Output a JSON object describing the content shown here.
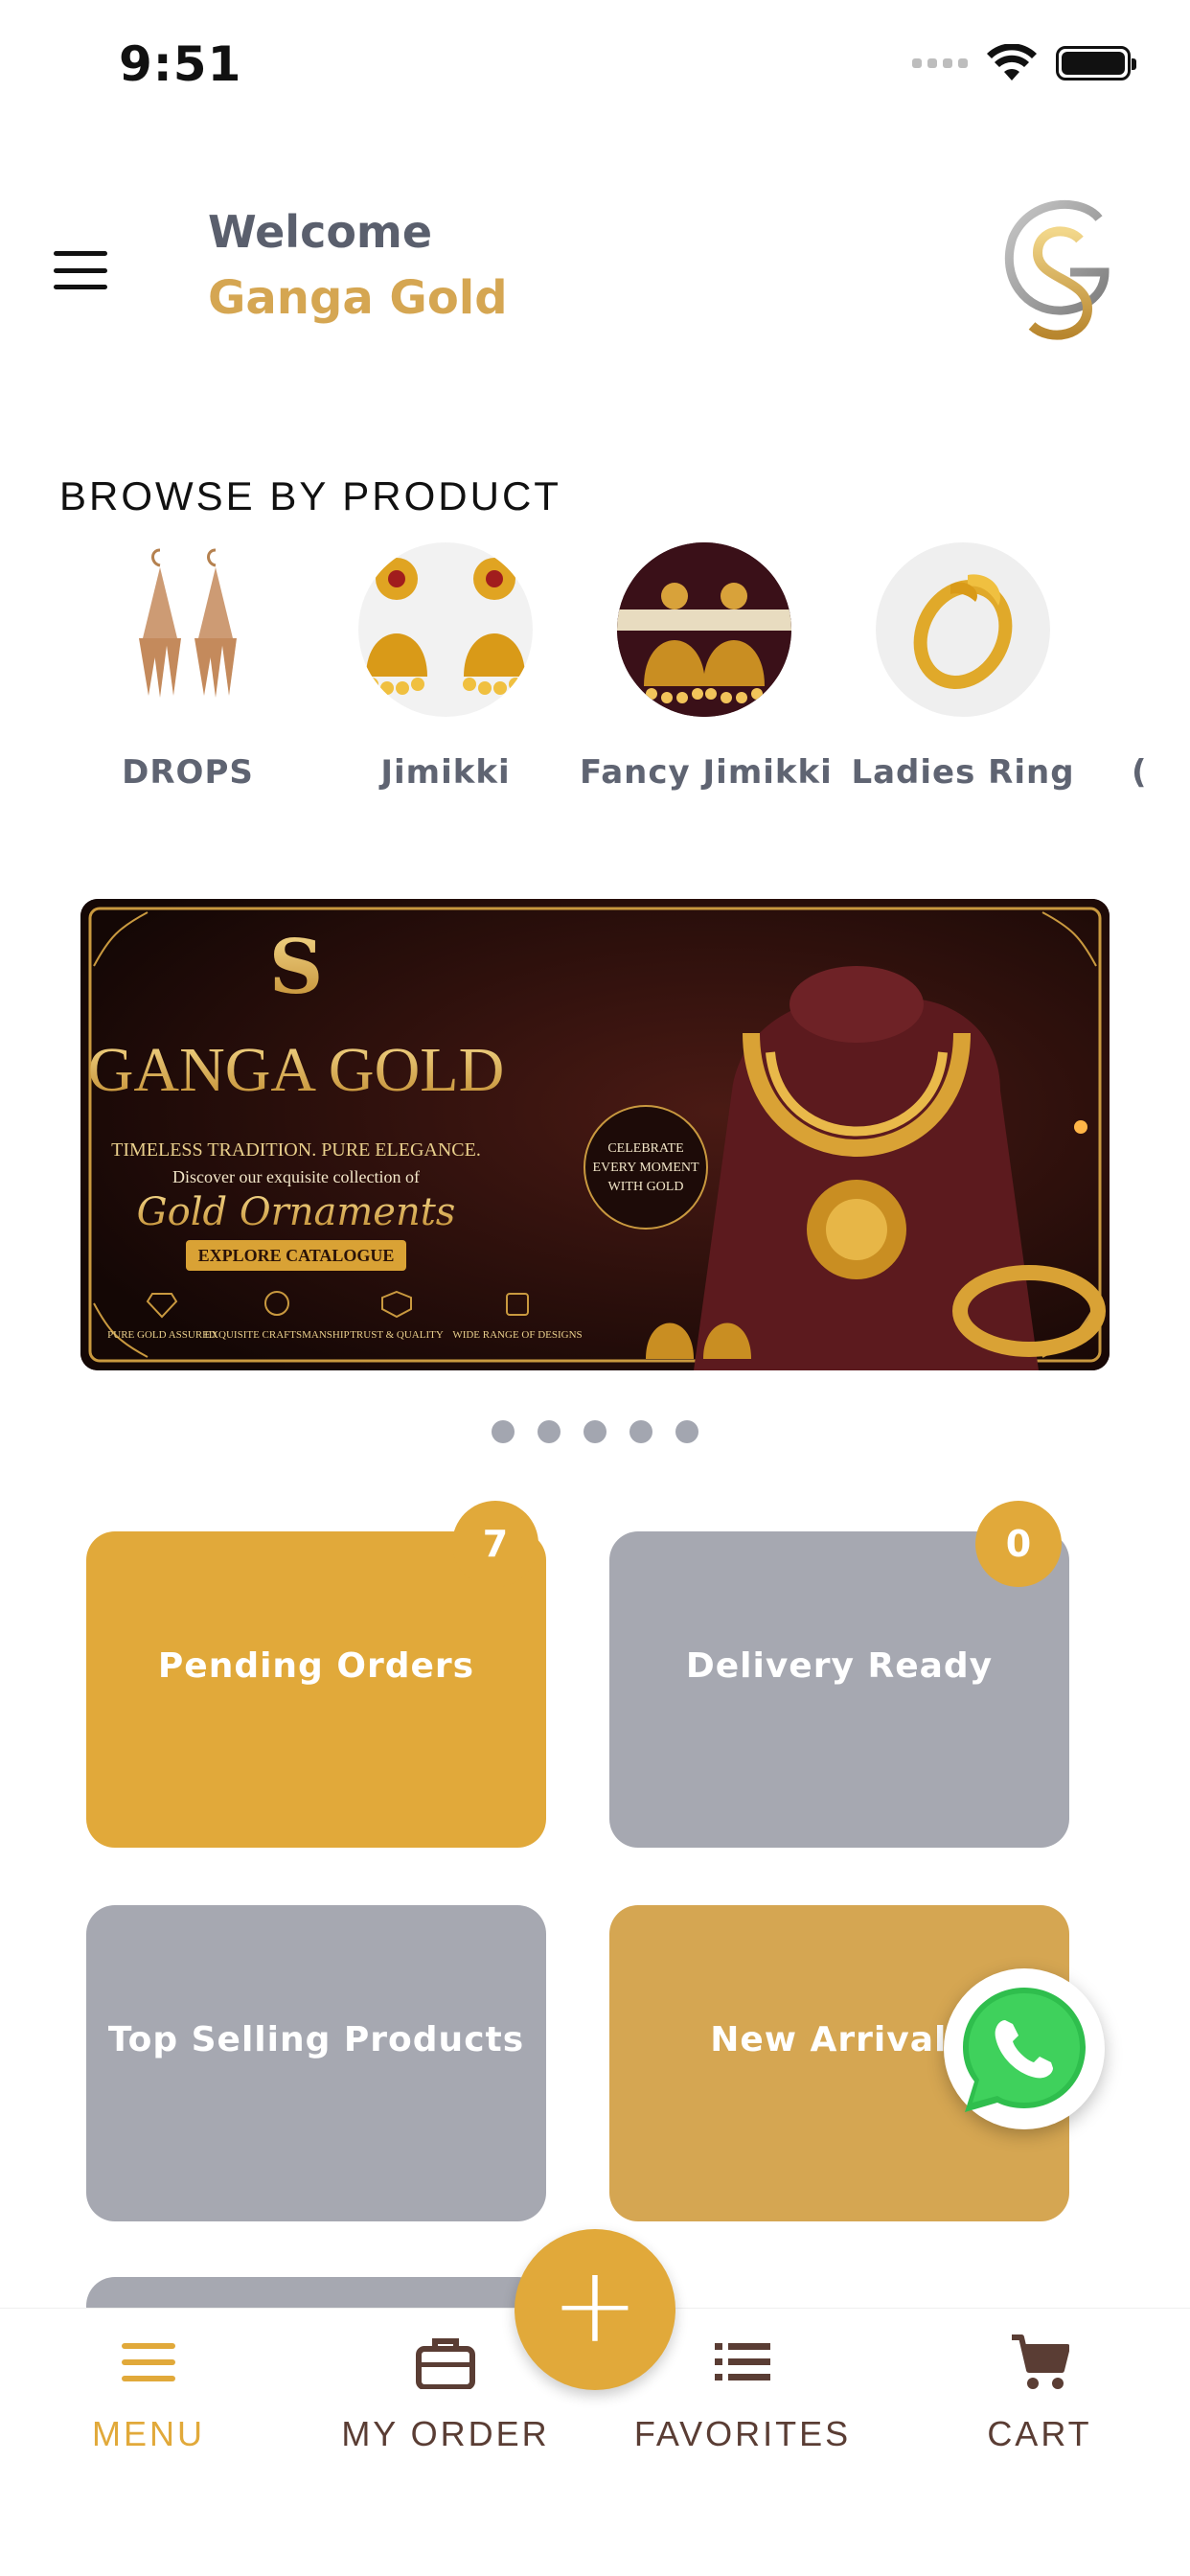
{
  "status_bar": {
    "time": "9:51"
  },
  "header": {
    "welcome": "Welcome",
    "store_name": "Ganga Gold"
  },
  "browse": {
    "title": "BROWSE BY PRODUCT",
    "items": [
      {
        "label": "DROPS",
        "icon": "drop-earrings-image"
      },
      {
        "label": "Jimikki",
        "icon": "jimikki-earrings-image"
      },
      {
        "label": "Fancy Jimikki",
        "icon": "fancy-jimikki-image"
      },
      {
        "label": "Ladies Ring",
        "icon": "ladies-ring-image"
      }
    ]
  },
  "banner": {
    "brand": "GANGA GOLD",
    "tagline": "TIMELESS TRADITION. PURE ELEGANCE.",
    "subline": "Discover our exquisite collection of",
    "script_title": "Gold Ornaments",
    "cta": "EXPLORE CATALOGUE",
    "seal": [
      "CELEBRATE",
      "EVERY MOMENT",
      "WITH GOLD"
    ],
    "features": [
      "PURE GOLD ASSURED",
      "EXQUISITE CRAFTSMANSHIP",
      "TRUST & QUALITY",
      "WIDE RANGE OF DESIGNS"
    ],
    "slides": 5,
    "active_slide": 1
  },
  "tiles": {
    "pending_orders": {
      "label": "Pending Orders",
      "badge": "7"
    },
    "delivery_ready": {
      "label": "Delivery Ready",
      "badge": "0"
    },
    "top_selling": {
      "label": "Top Selling Products"
    },
    "new_arrivals": {
      "label": "New Arrivals"
    }
  },
  "bottom_nav": {
    "menu": "MENU",
    "my_order": "MY ORDER",
    "favorites": "FAVORITES",
    "cart": "CART",
    "active": "MENU"
  },
  "fab": {
    "icon": "plus-icon"
  },
  "colors": {
    "gold": "#e1a93a",
    "gold_light": "#d5a652",
    "tile_grey": "#a6a8b1",
    "nav_brown": "#5a3d34"
  }
}
